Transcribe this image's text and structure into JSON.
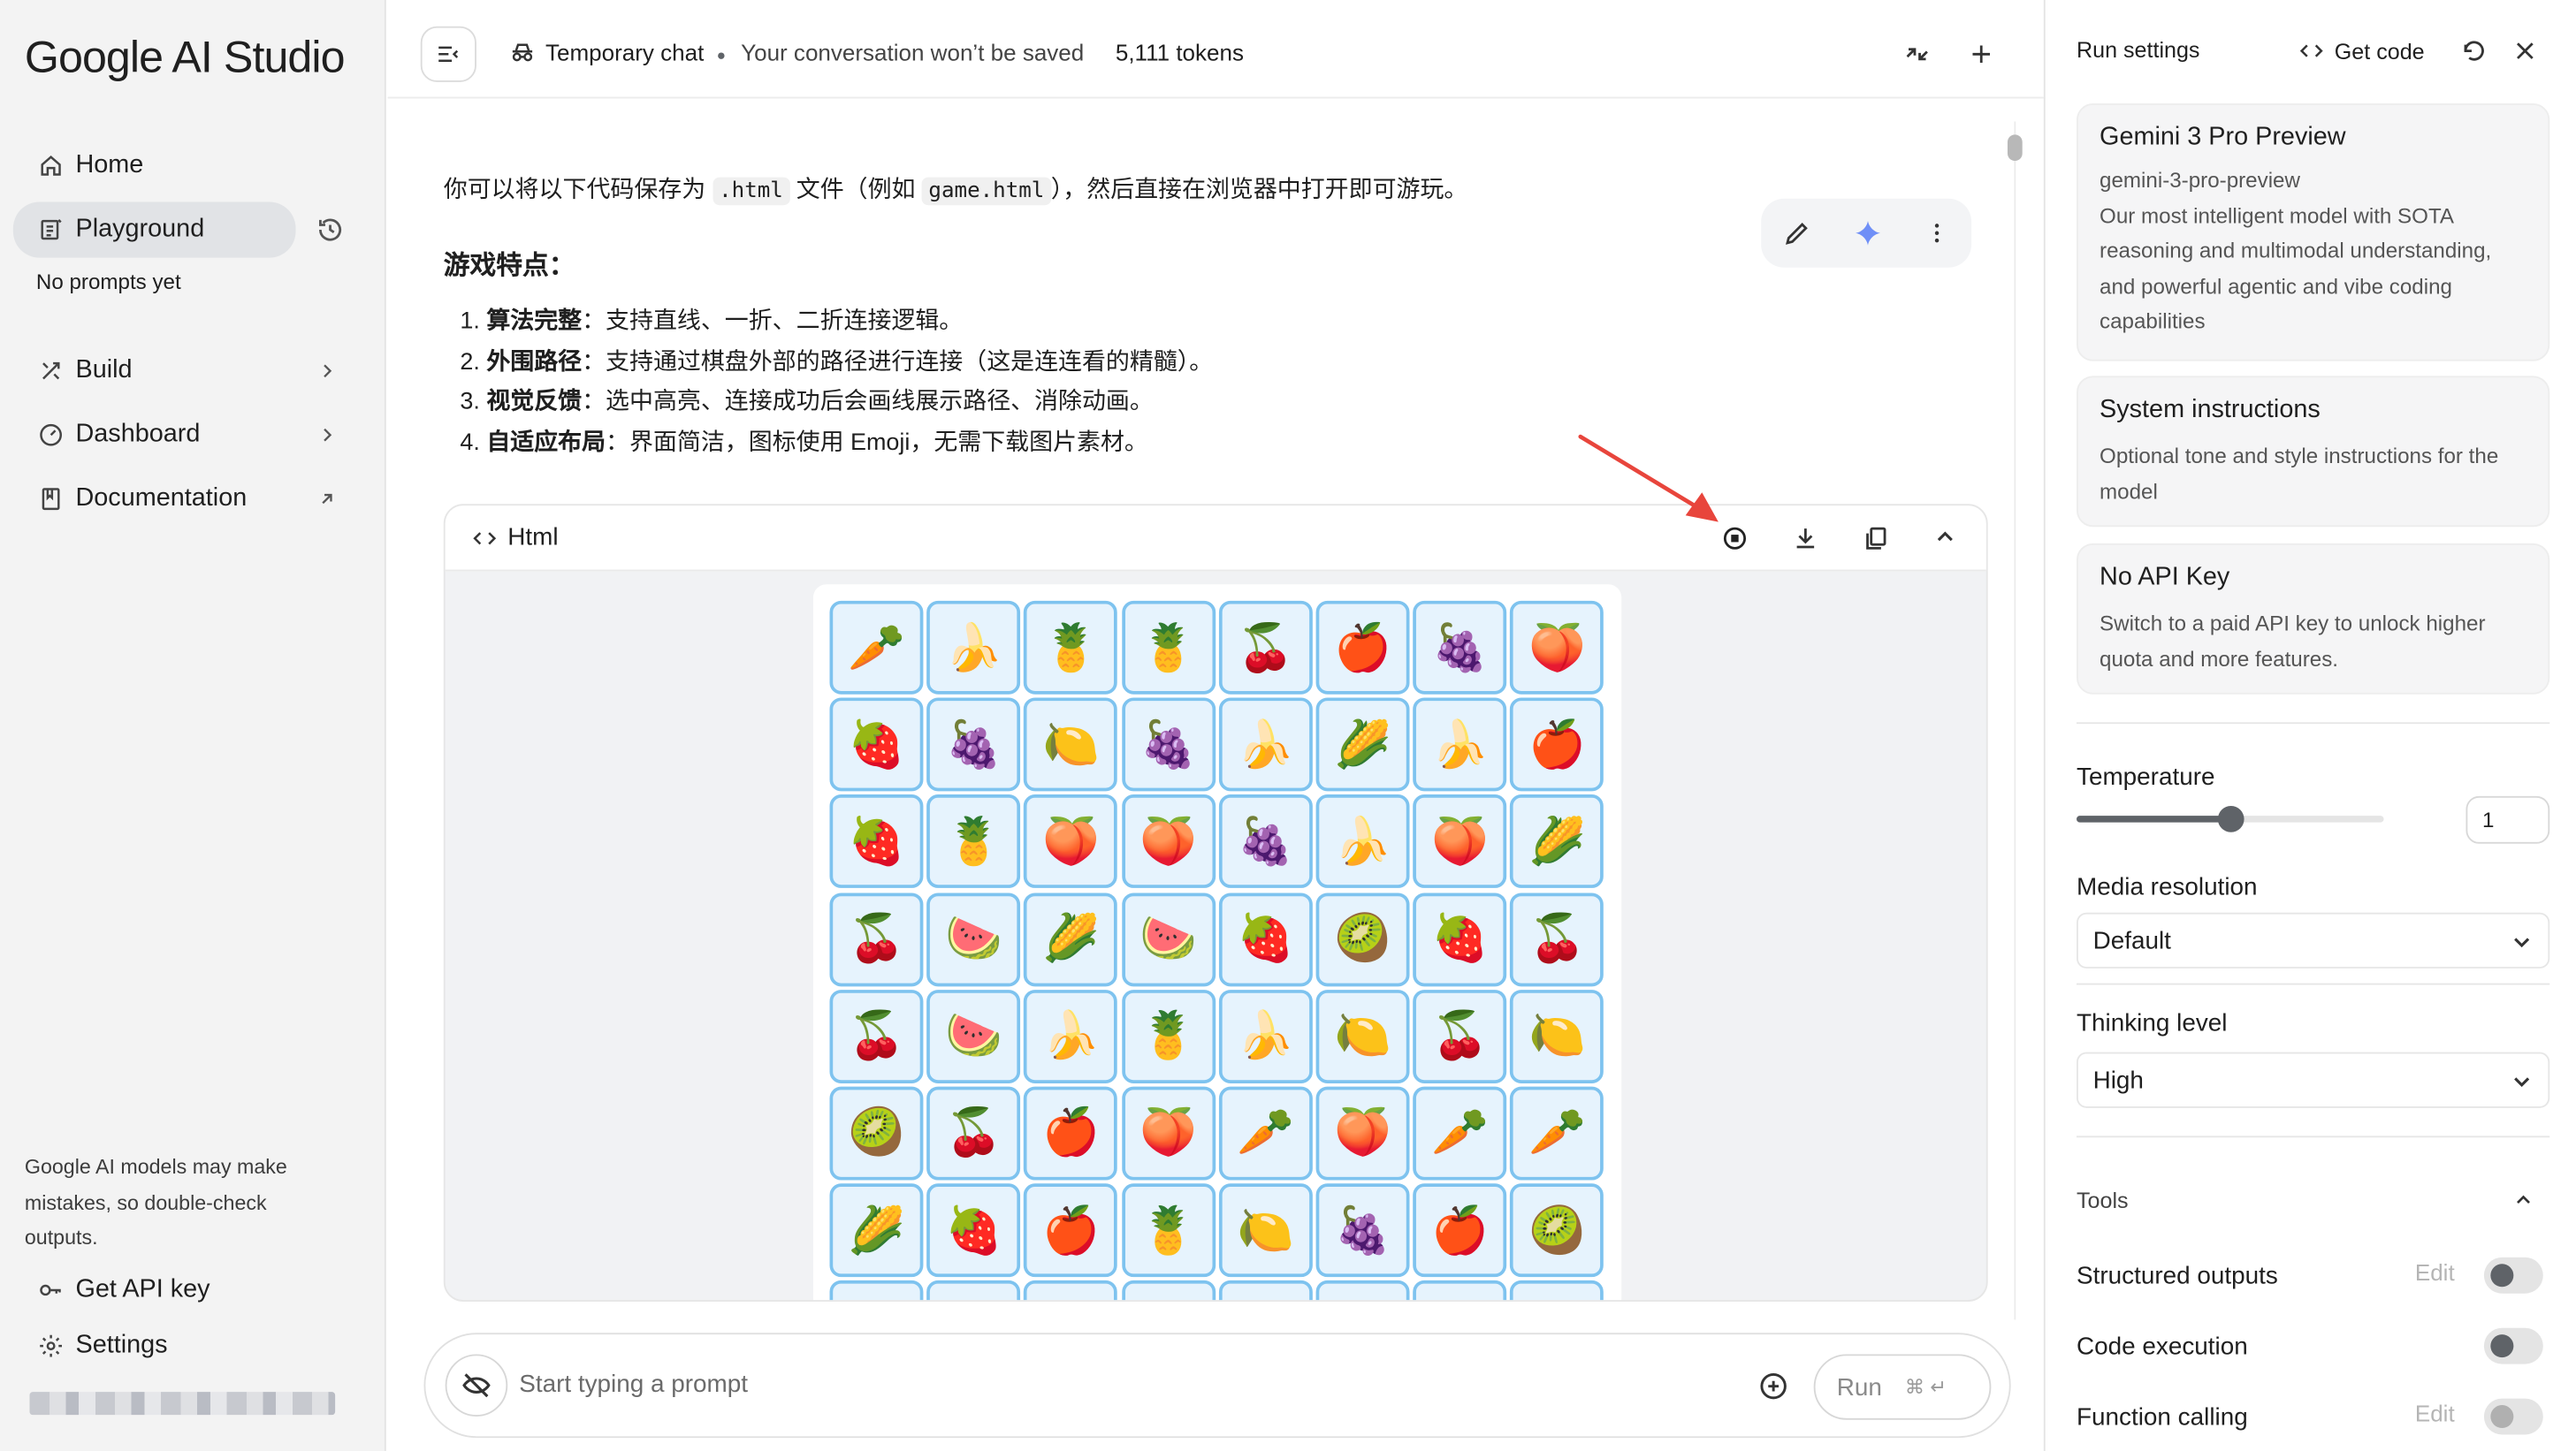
{
  "app": {
    "brand": "Google AI Studio"
  },
  "sidebar": {
    "home": "Home",
    "playground": "Playground",
    "no_prompts": "No prompts yet",
    "build": "Build",
    "dashboard": "Dashboard",
    "documentation": "Documentation",
    "disclaimer": "Google AI models may make mistakes, so double-check outputs.",
    "get_api_key": "Get API key",
    "settings": "Settings"
  },
  "topbar": {
    "temporary_chat": "Temporary chat",
    "not_saved": "Your conversation won’t be saved",
    "tokens": "5,111 tokens"
  },
  "response": {
    "intro_a": "你可以将以下代码保存为 ",
    "intro_code1": ".html",
    "intro_b": " 文件（例如 ",
    "intro_code2": "game.html",
    "intro_c": "），然后直接在浏览器中打开即可游玩。",
    "features_heading": "游戏特点：",
    "features": [
      {
        "num": "1.",
        "bold": "算法完整",
        "text": "：支持直线、一折、二折连接逻辑。"
      },
      {
        "num": "2.",
        "bold": "外围路径",
        "text": "：支持通过棋盘外部的路径进行连接（这是连连看的精髓）。"
      },
      {
        "num": "3.",
        "bold": "视觉反馈",
        "text": "：选中高亮、连接成功后会画线展示路径、消除动画。"
      },
      {
        "num": "4.",
        "bold": "自适应布局",
        "text": "：界面简洁，图标使用 Emoji，无需下载图片素材。"
      }
    ]
  },
  "code_block": {
    "label": "Html"
  },
  "game": {
    "tiles": [
      "🥕",
      "🍌",
      "🍍",
      "🍍",
      "🍒",
      "🍎",
      "🍇",
      "🍑",
      "🍓",
      "🍇",
      "🍋",
      "🍇",
      "🍌",
      "🌽",
      "🍌",
      "🍎",
      "🍓",
      "🍍",
      "🍑",
      "🍑",
      "🍇",
      "🍌",
      "🍑",
      "🌽",
      "🍒",
      "🍉",
      "🌽",
      "🍉",
      "🍓",
      "🥝",
      "🍓",
      "🍒",
      "🍒",
      "🍉",
      "🍌",
      "🍍",
      "🍌",
      "🍋",
      "🍒",
      "🍋",
      "🥝",
      "🍒",
      "🍎",
      "🍑",
      "🥕",
      "🍑",
      "🥕",
      "🥕",
      "🌽",
      "🍓",
      "🍎",
      "🍍",
      "🍋",
      "🍇",
      "🍎",
      "🥝",
      "",
      "",
      "",
      "",
      "",
      "",
      "",
      ""
    ]
  },
  "prompt": {
    "placeholder": "Start typing a prompt",
    "run": "Run",
    "shortcut": "⌘ ↵"
  },
  "run_settings": {
    "title": "Run settings",
    "get_code": "Get code",
    "model": {
      "name": "Gemini 3 Pro Preview",
      "id": "gemini-3-pro-preview",
      "description": "Our most intelligent model with SOTA reasoning and multimodal understanding, and powerful agentic and vibe coding capabilities"
    },
    "system_instructions": {
      "title": "System instructions",
      "hint": "Optional tone and style instructions for the model"
    },
    "api_key": {
      "title": "No API Key",
      "hint": "Switch to a paid API key to unlock higher quota and more features."
    },
    "temperature": {
      "label": "Temperature",
      "value": "1",
      "fraction": 0.5
    },
    "media_resolution": {
      "label": "Media resolution",
      "value": "Default"
    },
    "thinking_level": {
      "label": "Thinking level",
      "value": "High"
    },
    "tools": {
      "label": "Tools",
      "structured_outputs": {
        "label": "Structured outputs",
        "edit": "Edit",
        "on": false
      },
      "code_execution": {
        "label": "Code execution",
        "on": false
      },
      "function_calling": {
        "label": "Function calling",
        "edit": "Edit",
        "on": false
      }
    }
  },
  "colors": {
    "accent_blue": "#7ec3ef",
    "tile_bg": "#e6f3fd",
    "annotation_red": "#e8453c"
  }
}
